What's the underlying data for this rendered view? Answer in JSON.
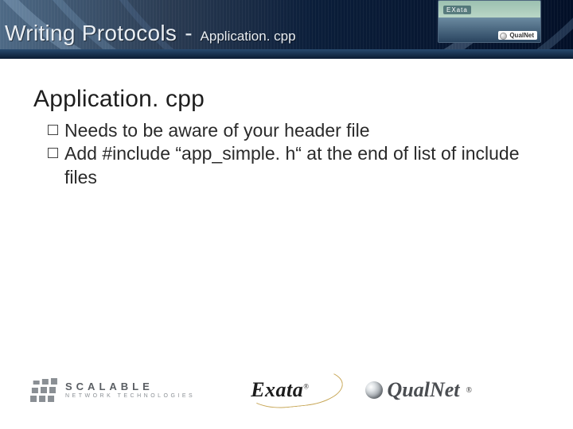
{
  "header": {
    "title_main": "Writing Protocols",
    "title_dash": "-",
    "title_sub": "Application. cpp",
    "inset_badge": "EXata",
    "inset_qn": "QualNet"
  },
  "body": {
    "heading": "Application. cpp",
    "bullets": [
      "Needs to be aware of your header file",
      "Add #include “app_simple. h“ at the end of list of include files"
    ]
  },
  "footer": {
    "scalable_line1": "SCALABLE",
    "scalable_line2": "NETWORK TECHNOLOGIES",
    "exata": "Exata",
    "exata_reg": "®",
    "qualnet": "QualNet",
    "qualnet_reg": "®"
  }
}
